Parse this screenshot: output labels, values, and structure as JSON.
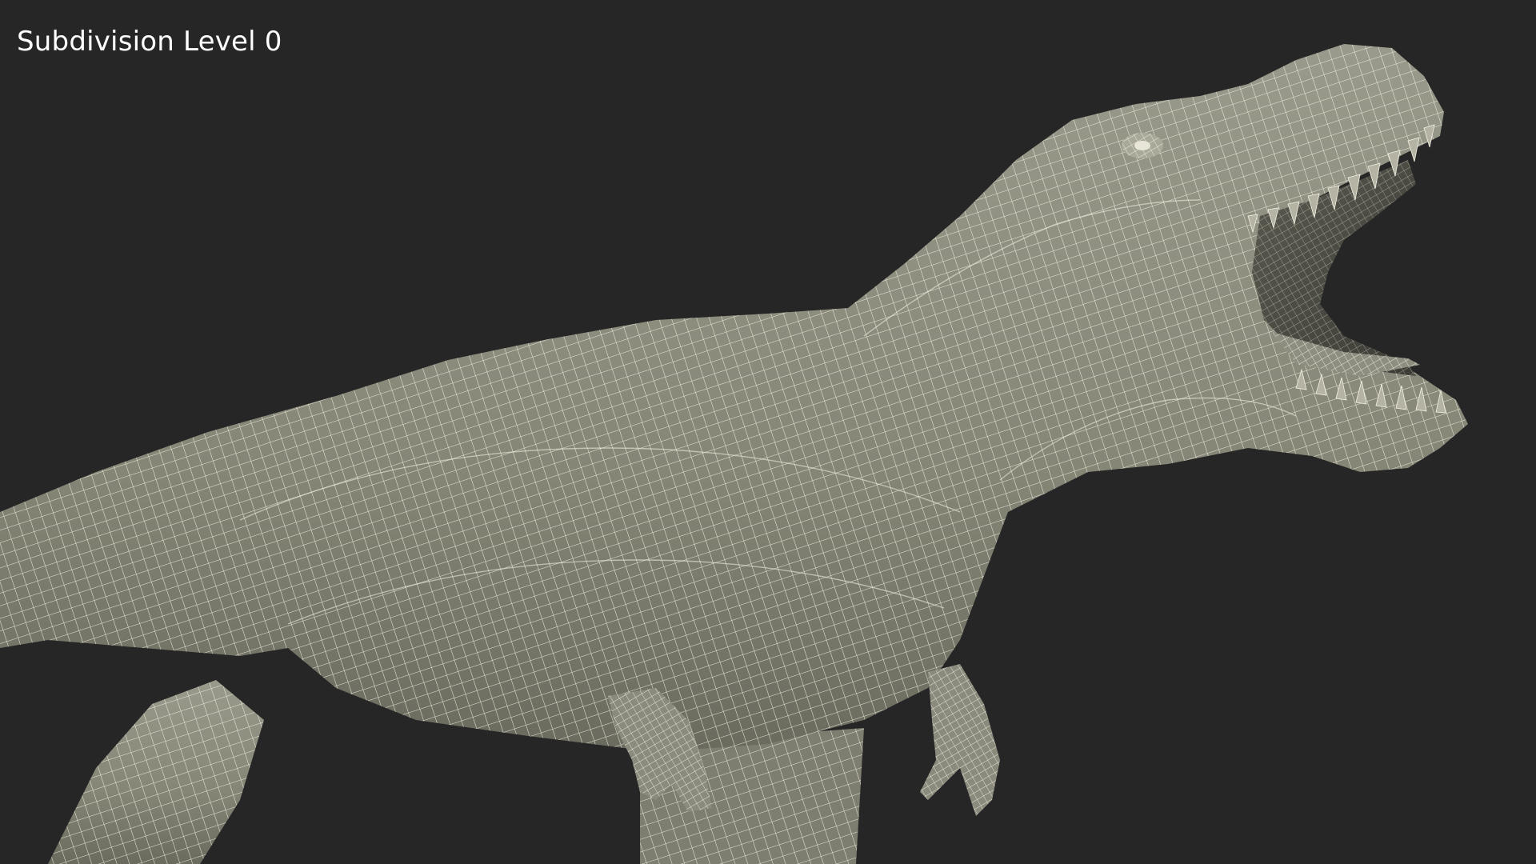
{
  "viewport": {
    "overlay_label": "Subdivision Level 0",
    "background_color": "#262626"
  },
  "model": {
    "subject": "dinosaur-wireframe",
    "surface_color": "#8a8a7d",
    "shadow_color": "#5f5f55",
    "wire_color": "#f4f2e4"
  }
}
